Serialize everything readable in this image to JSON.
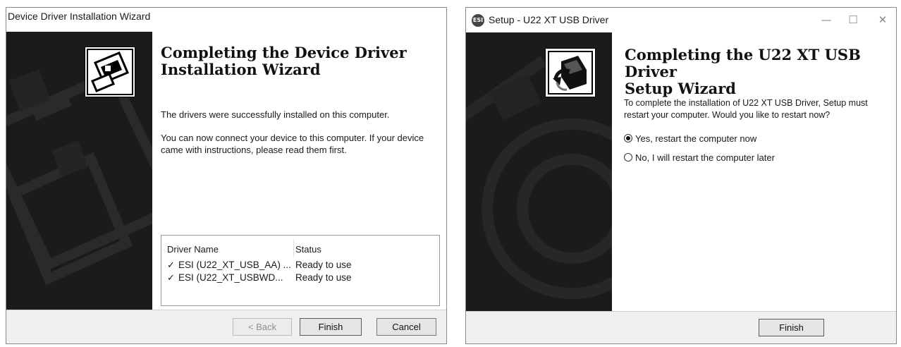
{
  "wizard1": {
    "window_title": "Device Driver Installation Wizard",
    "side_icon": "driver-install-icon",
    "heading_line1": "Completing the Device Driver",
    "heading_line2": "Installation Wizard",
    "success_text": "The drivers were successfully installed on this computer.",
    "info_line1": "You can now connect your device to this computer. If your device",
    "info_line2": "came with instructions, please read them first.",
    "table": {
      "col_driver": "Driver Name",
      "col_status": "Status",
      "rows": [
        {
          "check": "✓",
          "name": "ESI (U22_XT_USB_AA) ...",
          "status": "Ready to use"
        },
        {
          "check": "✓",
          "name": "ESI (U22_XT_USBWD...",
          "status": "Ready to use"
        }
      ]
    },
    "buttons": {
      "back": "< Back",
      "finish": "Finish",
      "cancel": "Cancel"
    }
  },
  "wizard2": {
    "window_title": "Setup - U22 XT USB Driver",
    "app_icon_text": "ESI",
    "controls": {
      "minimize": "—",
      "maximize": "☐",
      "close": "✕"
    },
    "side_icon": "usb-driver-setup-icon",
    "heading_line1": "Completing the U22 XT USB Driver",
    "heading_line2": "Setup Wizard",
    "text_line1": "To complete the installation of U22 XT USB Driver, Setup must",
    "text_line2": "restart your computer. Would you like to restart now?",
    "options": [
      {
        "label": "Yes, restart the computer now",
        "selected": true
      },
      {
        "label": "No, I will restart the computer later",
        "selected": false
      }
    ],
    "buttons": {
      "finish": "Finish"
    }
  },
  "colors": {
    "side_panel": "#1b1b1b",
    "footer": "#f0f0f0"
  }
}
